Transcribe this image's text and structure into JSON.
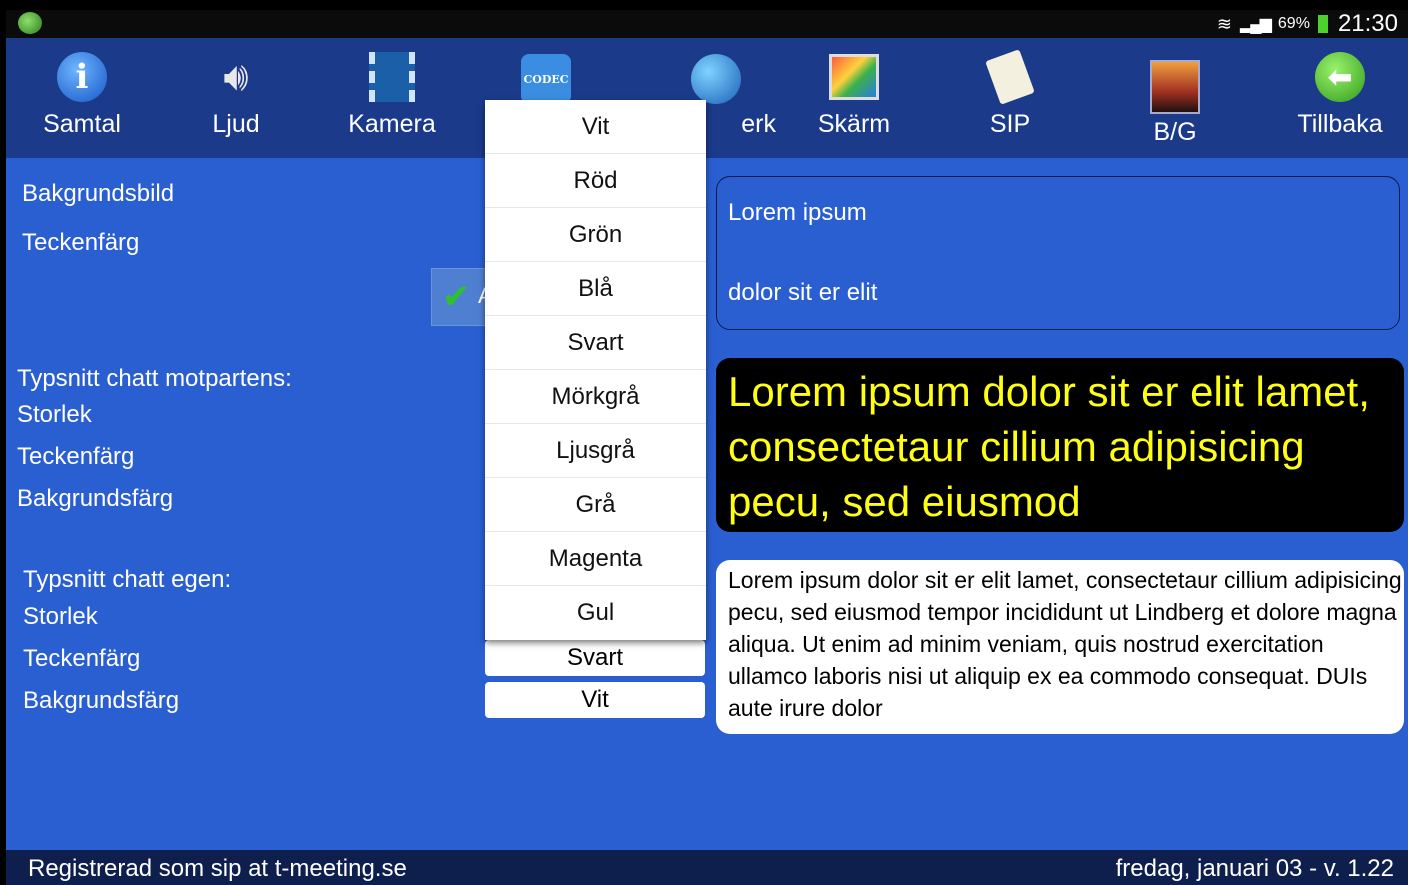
{
  "statusbar": {
    "battery": "69%",
    "time": "21:30"
  },
  "toolbar": {
    "items": [
      {
        "label": "Samtal",
        "icon": "info-icon"
      },
      {
        "label": "Ljud",
        "icon": "speaker-icon"
      },
      {
        "label": "Kamera",
        "icon": "film-icon"
      },
      {
        "label": "",
        "icon": "codec-icon",
        "icon_text": "CODEC"
      },
      {
        "label": "erk",
        "icon": "globe-icon"
      },
      {
        "label": "Skärm",
        "icon": "screen-icon"
      },
      {
        "label": "SIP",
        "icon": "document-icon"
      },
      {
        "label": "B/G",
        "icon": "background-icon"
      },
      {
        "label": "Tillbaka",
        "icon": "back-arrow-icon"
      }
    ]
  },
  "settings": {
    "bakgrundsbild": "Bakgrundsbild",
    "teckenfarg_top": "Teckenfärg",
    "apply_label": "A",
    "motpart_heading": "Typsnitt chatt motpartens:",
    "motpart_storlek": "Storlek",
    "motpart_teckenfarg": "Teckenfärg",
    "motpart_bakgrundsfarg": "Bakgrundsfärg",
    "egen_heading": "Typsnitt chatt egen:",
    "egen_storlek": "Storlek",
    "egen_teckenfarg": "Teckenfärg",
    "egen_bakgrundsfarg": "Bakgrundsfärg",
    "egen_teckenfarg_value": "Svart",
    "egen_bakgrundsfarg_value": "Vit"
  },
  "dropdown": {
    "options": [
      "Vit",
      "Röd",
      "Grön",
      "Blå",
      "Svart",
      "Mörkgrå",
      "Ljusgrå",
      "Grå",
      "Magenta",
      "Gul"
    ]
  },
  "preview": {
    "box1_line1": "Lorem ipsum",
    "box1_line2": "dolor sit er elit",
    "box2_text": "Lorem ipsum dolor sit er elit lamet, consectetaur cillium adipisicing pecu, sed eiusmod",
    "box3_text": "Lorem ipsum dolor sit er elit lamet, consectetaur cillium adipisicing pecu, sed eiusmod tempor incididunt ut Lindberg et dolore magna aliqua. Ut enim ad minim veniam, quis nostrud exercitation ullamco laboris nisi ut aliquip ex ea commodo consequat. DUIs aute irure dolor"
  },
  "footer": {
    "left": "Registrerad som sip at t-meeting.se",
    "right": "fredag, januari 03 - v. 1.22"
  },
  "colors": {
    "background": "#2a5fd1",
    "toolbar": "#1b3a8a",
    "highlight_text": "#ffff14"
  }
}
